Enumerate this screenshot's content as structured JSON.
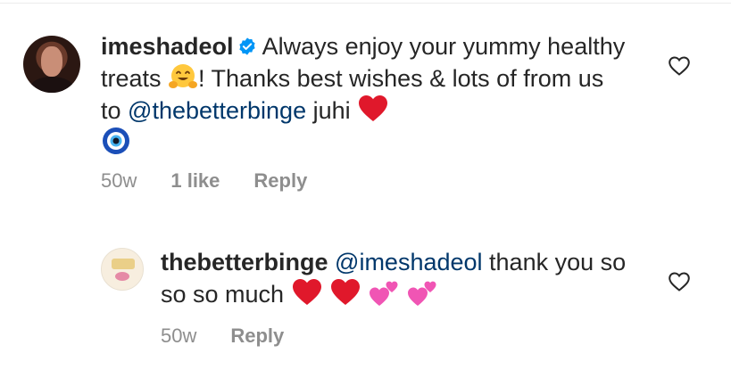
{
  "comment": {
    "username": "imeshadeol",
    "text_part1": "Always enjoy your yummy healthy treats ",
    "text_part2": "! Thanks best wishes & lots of from us to ",
    "mention": "@thebetterbinge",
    "text_part3": " juhi ",
    "emojis": [
      "hugging-face-emoji",
      "red-heart-emoji",
      "nazar-amulet-emoji"
    ],
    "time": "50w",
    "likes": "1 like",
    "reply_label": "Reply"
  },
  "reply": {
    "username": "thebetterbinge",
    "mention": "@imeshadeol",
    "text": " thank you so so so much ",
    "emojis": [
      "red-heart-emoji",
      "red-heart-emoji",
      "two-hearts-emoji",
      "two-hearts-emoji"
    ],
    "time": "50w",
    "reply_label": "Reply"
  },
  "colors": {
    "text": "#262626",
    "mention": "#00376b",
    "meta": "#8e8e8e",
    "verified": "#0095f6",
    "heart": "#e0182b",
    "pink_heart": "#f055b4"
  }
}
